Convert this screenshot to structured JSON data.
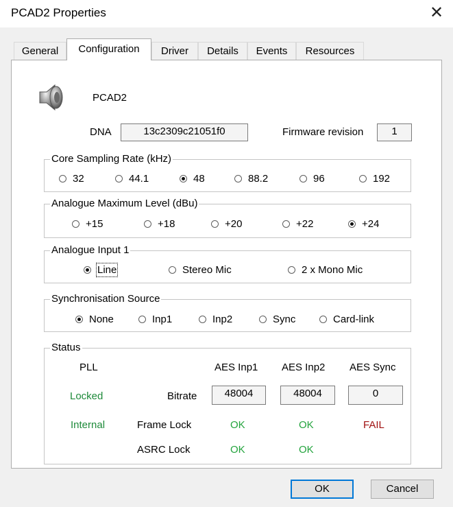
{
  "window": {
    "title": "PCAD2 Properties",
    "close_glyph": "✕"
  },
  "tabs": [
    {
      "label": "General"
    },
    {
      "label": "Configuration"
    },
    {
      "label": "Driver"
    },
    {
      "label": "Details"
    },
    {
      "label": "Events"
    },
    {
      "label": "Resources"
    }
  ],
  "device": {
    "icon": "speaker-icon",
    "name": "PCAD2",
    "dna_label": "DNA",
    "dna_value": "13c2309c21051f0",
    "firmware_label": "Firmware revision",
    "firmware_value": "1"
  },
  "sampling": {
    "legend": "Core Sampling Rate (kHz)",
    "options": [
      "32",
      "44.1",
      "48",
      "88.2",
      "96",
      "192"
    ],
    "selected": "48"
  },
  "analogue_level": {
    "legend": "Analogue Maximum Level (dBu)",
    "options": [
      "+15",
      "+18",
      "+20",
      "+22",
      "+24"
    ],
    "selected": "+24"
  },
  "analogue_input": {
    "legend": "Analogue Input 1",
    "options": [
      "Line",
      "Stereo Mic",
      "2 x Mono Mic"
    ],
    "selected": "Line"
  },
  "sync_source": {
    "legend": "Synchronisation Source",
    "options": [
      "None",
      "Inp1",
      "Inp2",
      "Sync",
      "Card-link"
    ],
    "selected": "None"
  },
  "status": {
    "legend": "Status",
    "pll_header": "PLL",
    "col_headers": [
      "AES Inp1",
      "AES Inp2",
      "AES Sync"
    ],
    "pll_locked": "Locked",
    "pll_source": "Internal",
    "bitrate_label": "Bitrate",
    "bitrate_values": [
      "48004",
      "48004",
      "0"
    ],
    "frame_lock_label": "Frame Lock",
    "frame_lock_values": [
      "OK",
      "OK",
      "FAIL"
    ],
    "asrc_lock_label": "ASRC Lock",
    "asrc_lock_values": [
      "OK",
      "OK"
    ]
  },
  "buttons": {
    "ok": "OK",
    "cancel": "Cancel"
  },
  "colors": {
    "ok_green": "#22a33c",
    "locked_green": "#1e8a3a",
    "fail_red": "#a01010",
    "default_button_border": "#0078d7"
  }
}
